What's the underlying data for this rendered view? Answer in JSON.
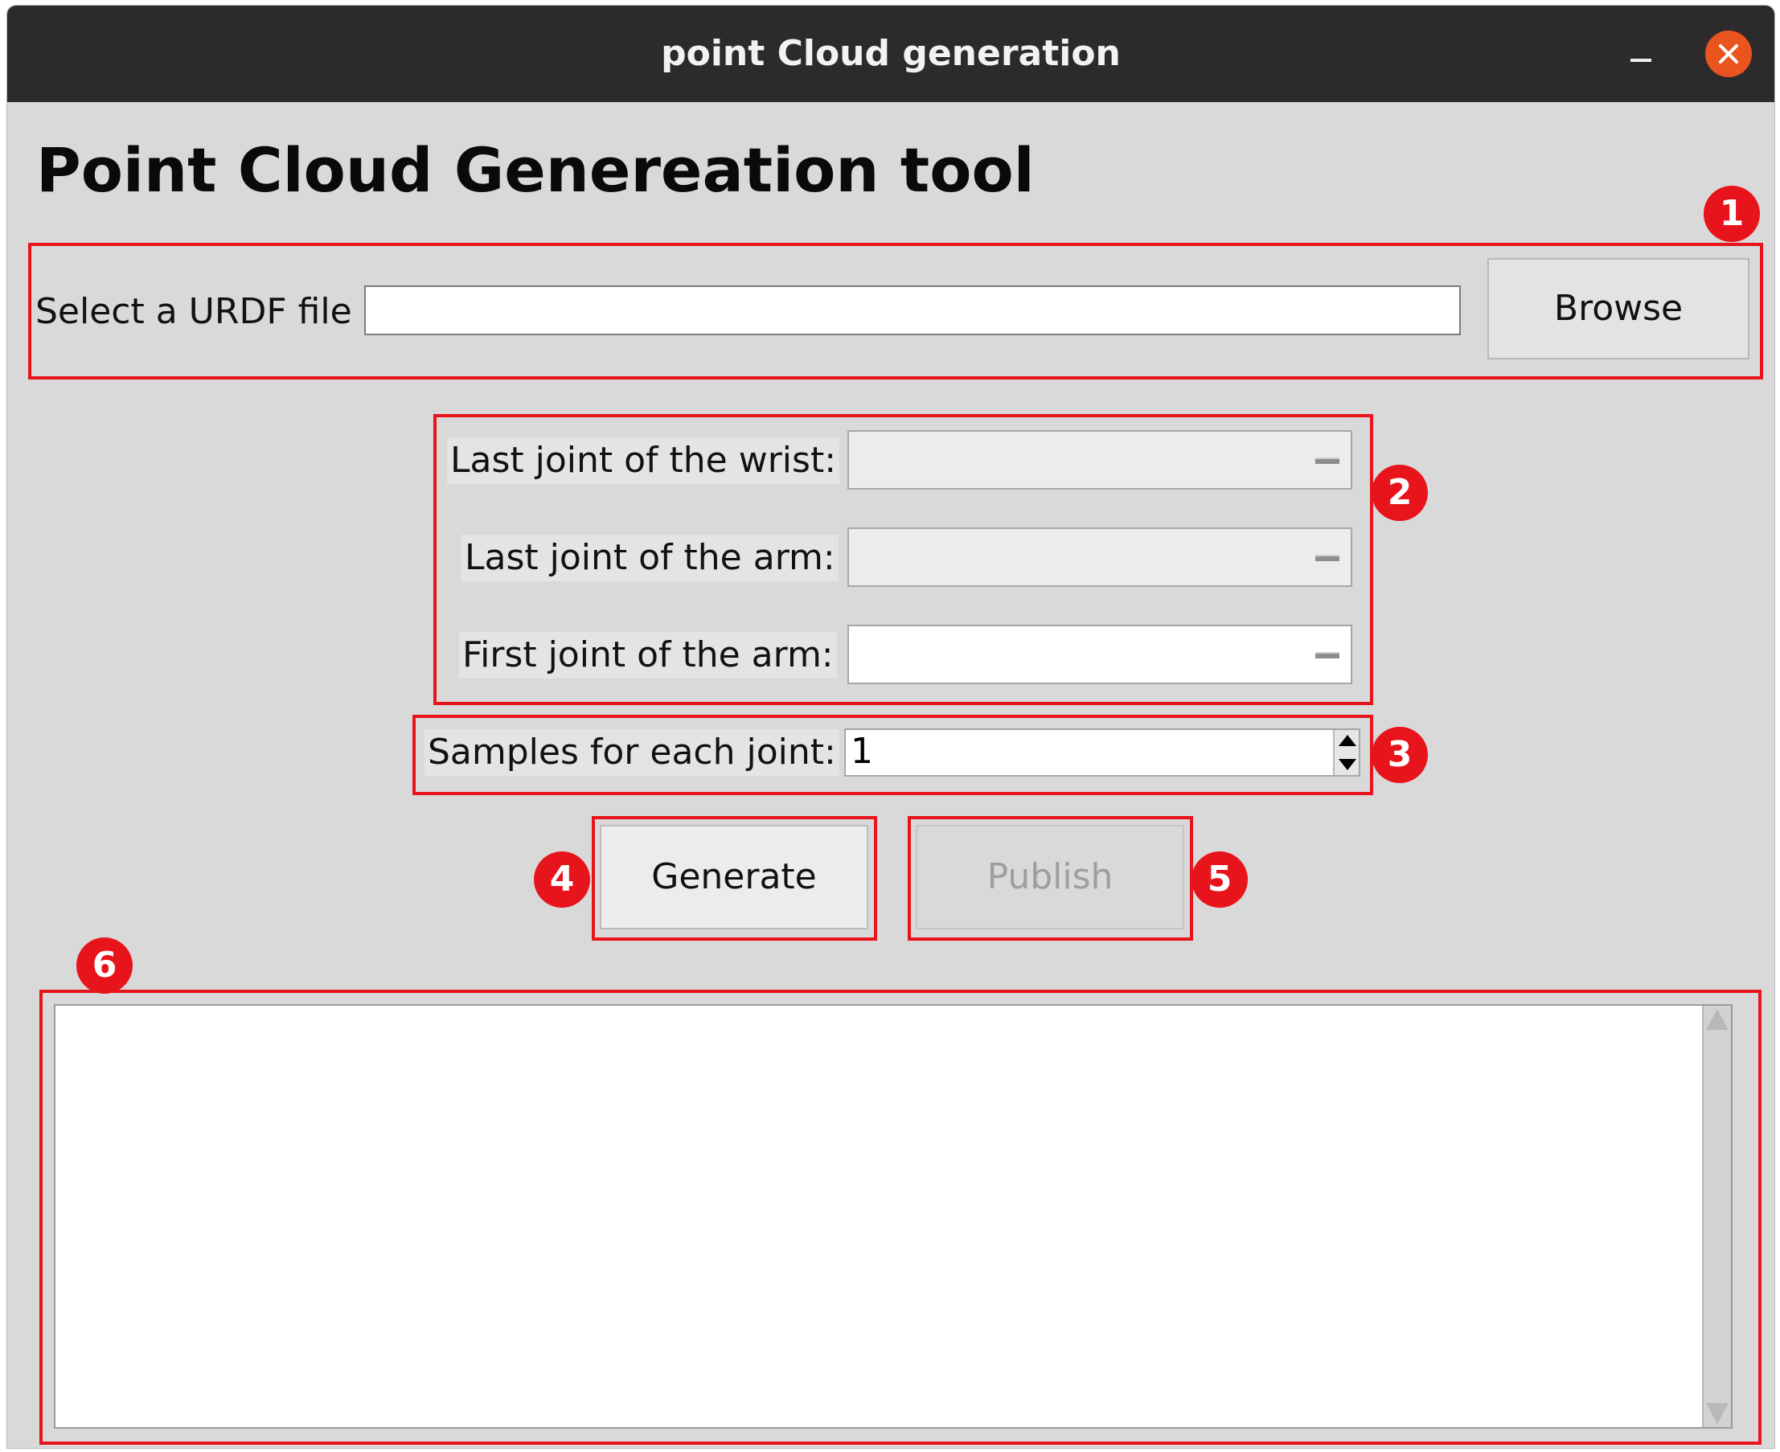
{
  "window": {
    "title": "point Cloud generation",
    "close_color": "#e9541f"
  },
  "heading": "Point Cloud Genereation tool",
  "urdf": {
    "label": "Select a URDF file",
    "value": "",
    "browse_label": "Browse"
  },
  "joints": {
    "wrist_label": "Last joint of the wrist:",
    "wrist_value": "",
    "arm_last_label": "Last joint of the arm:",
    "arm_last_value": "",
    "arm_first_label": "First joint of the arm:",
    "arm_first_value": ""
  },
  "samples": {
    "label": "Samples for each joint:",
    "value": "1"
  },
  "actions": {
    "generate_label": "Generate",
    "publish_label": "Publish"
  },
  "output": {
    "text": ""
  },
  "annotations": {
    "color": "#e8141c",
    "badges": [
      "1",
      "2",
      "3",
      "4",
      "5",
      "6"
    ]
  }
}
